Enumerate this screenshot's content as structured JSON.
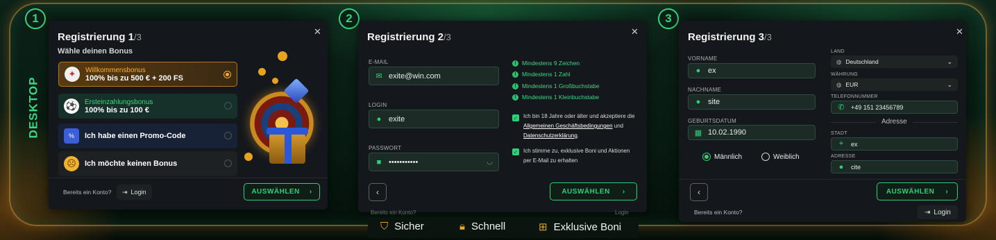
{
  "side_label": "DESKTOP",
  "steps": [
    "1",
    "2",
    "3"
  ],
  "panel1": {
    "title": "Registrierung 1",
    "title_suffix": "/3",
    "subtitle": "Wähle deinen Bonus",
    "close": "✕",
    "bonuses": [
      {
        "label": "Willkommensbonus",
        "value": "100% bis zu 500 € + 200 FS",
        "color": "#ffae2b"
      },
      {
        "label": "Ersteinzahlungsbonus",
        "value": "100% bis zu 100 €",
        "color": "#39d784"
      },
      {
        "label": "",
        "value": "Ich habe einen Promo-Code"
      },
      {
        "label": "",
        "value": "Ich möchte keinen Bonus"
      }
    ],
    "account_text": "Bereits ein Konto?",
    "login": "Login",
    "select_button": "AUSWÄHLEN"
  },
  "panel2": {
    "title": "Registrierung 2",
    "title_suffix": "/3",
    "close": "✕",
    "email_label": "E-MAIL",
    "email_value": "exite@win.com",
    "login_label": "LOGIN",
    "login_value": "exite",
    "password_label": "PASSWORT",
    "password_value": "•••••••••••",
    "requirements": [
      "Mindestens 9 Zeichen",
      "Mindestens 1 Zahl",
      "Mindestens 1 Großbuchstabe",
      "Mindestens 1 Kleinbuchstabe"
    ],
    "consent1_a": "Ich bin 18 Jahre oder älter und akzeptiere die",
    "consent1_b": "Allgemeinen Geschäftsbedingungen",
    "consent1_c": "und",
    "consent1_d": "Datenschutzerklärung",
    "consent1_e": ".",
    "consent2_a": "Ich stimme zu, exklusive Boni und Aktionen",
    "consent2_b": "per E-Mail zu erhalten",
    "select_button": "AUSWÄHLEN",
    "account_text": "Bereits ein Konto?",
    "login": "Login"
  },
  "panel3": {
    "title": "Registrierung 3",
    "title_suffix": "/3",
    "close": "✕",
    "first_name_label": "VORNAME",
    "first_name_value": "ex",
    "last_name_label": "NACHNAME",
    "last_name_value": "site",
    "birth_label": "GEBURTSDATUM",
    "birth_value": "10.02.1990",
    "gender_male": "Männlich",
    "gender_female": "Weiblich",
    "country_label": "LAND",
    "country_value": "Deutschland",
    "currency_label": "WÄHRUNG",
    "currency_value": "EUR",
    "phone_label": "TELEFONNUMMER",
    "phone_value": "+49 151 23456789",
    "address_header": "Adresse",
    "city_label": "STADT",
    "city_value": "ex",
    "address_label": "ADRESSE",
    "address_value": "cite",
    "select_button": "AUSWÄHLEN",
    "account_text": "Bereits ein Konto?",
    "login": "Login"
  },
  "features": [
    "Sicher",
    "Schnell",
    "Exklusive Boni"
  ],
  "colors": {
    "accent": "#2fcf7a",
    "gold": "#e3a52a",
    "panel": "#14181d"
  }
}
